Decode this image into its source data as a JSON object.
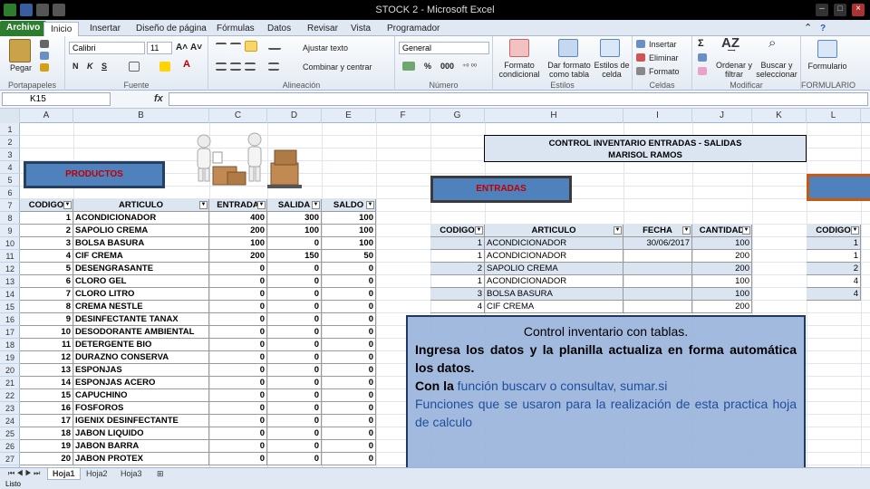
{
  "window": {
    "title": "STOCK 2  -  Microsoft Excel"
  },
  "ribbon_tabs": [
    "Archivo",
    "Inicio",
    "Insertar",
    "Diseño de página",
    "Fórmulas",
    "Datos",
    "Revisar",
    "Vista",
    "Programador"
  ],
  "ribbon": {
    "paste": "Pegar",
    "clipboard": "Portapapeles",
    "font_name": "Calibri",
    "font_size": "11",
    "font_group": "Fuente",
    "wrap_text": "Ajustar texto",
    "merge_center": "Combinar y centrar",
    "alignment_group": "Alineación",
    "number_format": "General",
    "number_group": "Número",
    "conditional_format": "Formato condicional",
    "format_table": "Dar formato como tabla",
    "cell_styles": "Estilos de celda",
    "styles_group": "Estilos",
    "insert": "Insertar",
    "delete": "Eliminar",
    "format": "Formato",
    "cells_group": "Celdas",
    "sort_filter": "Ordenar y filtrar",
    "find_select": "Buscar y seleccionar",
    "modify_group": "Modificar",
    "formulario": "Formulario",
    "formulario_group": "FORMULARIO",
    "bold": "N",
    "italic": "K",
    "underline": "S",
    "percent": "%",
    "thousands": "000"
  },
  "formula_bar": {
    "name_box": "K15",
    "fx": "fx",
    "content": ""
  },
  "columns": [
    "A",
    "B",
    "C",
    "D",
    "E",
    "F",
    "G",
    "H",
    "I",
    "J",
    "K",
    "L"
  ],
  "rows": [
    "1",
    "2",
    "3",
    "4",
    "5",
    "6",
    "7",
    "8",
    "9",
    "10",
    "11",
    "12",
    "13",
    "14",
    "15",
    "16",
    "17",
    "18",
    "19",
    "20",
    "21",
    "22",
    "23",
    "24",
    "25",
    "26",
    "27"
  ],
  "labels": {
    "productos": "PRODUCTOS",
    "entradas": "ENTRADAS",
    "title_line1": "CONTROL INVENTARIO ENTRADAS - SALIDAS",
    "title_line2": "MARISOL RAMOS"
  },
  "products_table": {
    "headers": [
      "CODIGO",
      "ARTICULO",
      "ENTRADA",
      "SALIDA",
      "SALDO"
    ],
    "rows": [
      [
        "1",
        "ACONDICIONADOR",
        "400",
        "300",
        "100"
      ],
      [
        "2",
        "SAPOLIO CREMA",
        "200",
        "100",
        "100"
      ],
      [
        "3",
        "BOLSA BASURA",
        "100",
        "0",
        "100"
      ],
      [
        "4",
        "CIF CREMA",
        "200",
        "150",
        "50"
      ],
      [
        "5",
        "DESENGRASANTE",
        "0",
        "0",
        "0"
      ],
      [
        "6",
        "CLORO GEL",
        "0",
        "0",
        "0"
      ],
      [
        "7",
        "CLORO LITRO",
        "0",
        "0",
        "0"
      ],
      [
        "8",
        "CREMA NESTLE",
        "0",
        "0",
        "0"
      ],
      [
        "9",
        "DESINFECTANTE TANAX",
        "0",
        "0",
        "0"
      ],
      [
        "10",
        "DESODORANTE AMBIENTAL",
        "0",
        "0",
        "0"
      ],
      [
        "11",
        "DETERGENTE BIO",
        "0",
        "0",
        "0"
      ],
      [
        "12",
        "DURAZNO CONSERVA",
        "0",
        "0",
        "0"
      ],
      [
        "13",
        "ESPONJAS",
        "0",
        "0",
        "0"
      ],
      [
        "14",
        "ESPONJAS ACERO",
        "0",
        "0",
        "0"
      ],
      [
        "15",
        "CAPUCHINO",
        "0",
        "0",
        "0"
      ],
      [
        "16",
        "FOSFOROS",
        "0",
        "0",
        "0"
      ],
      [
        "17",
        "IGENIX DESINFECTANTE",
        "0",
        "0",
        "0"
      ],
      [
        "18",
        "JABON LIQUIDO",
        "0",
        "0",
        "0"
      ],
      [
        "19",
        "JABON BARRA",
        "0",
        "0",
        "0"
      ],
      [
        "20",
        "JABON PROTEX",
        "0",
        "0",
        "0"
      ]
    ]
  },
  "entries_table": {
    "headers": [
      "CODIGO",
      "ARTICULO",
      "FECHA",
      "CANTIDAD"
    ],
    "rows": [
      [
        "1",
        "ACONDICIONADOR",
        "30/06/2017",
        "100"
      ],
      [
        "1",
        "ACONDICIONADOR",
        "",
        "200"
      ],
      [
        "2",
        "SAPOLIO CREMA",
        "",
        "200"
      ],
      [
        "1",
        "ACONDICIONADOR",
        "",
        "100"
      ],
      [
        "3",
        "BOLSA BASURA",
        "",
        "100"
      ],
      [
        "4",
        "CIF CREMA",
        "",
        "200"
      ]
    ]
  },
  "right_table": {
    "header": "CODIGO",
    "rows": [
      "1",
      "1",
      "2",
      "4",
      "4"
    ]
  },
  "overlay": {
    "title": "Control inventario con tablas.",
    "line1": "Ingresa los datos y la planilla actualiza en forma automática los datos.",
    "line2_prefix": "Con la ",
    "line2_highlight": "función buscarv o consultav, sumar.si",
    "line3": "Funciones que se usaron para la realización de esta practica hoja de calculo"
  },
  "sheet_tabs": [
    "Hoja1",
    "Hoja2",
    "Hoja3"
  ],
  "status": {
    "ready": "Listo"
  },
  "colors": {
    "accent_blue": "#4f81bd",
    "dark_blue": "#243f60",
    "label_red": "#c00000",
    "overlay_bg": "#9bb4dc",
    "highlight_text": "#1f4e9c"
  }
}
